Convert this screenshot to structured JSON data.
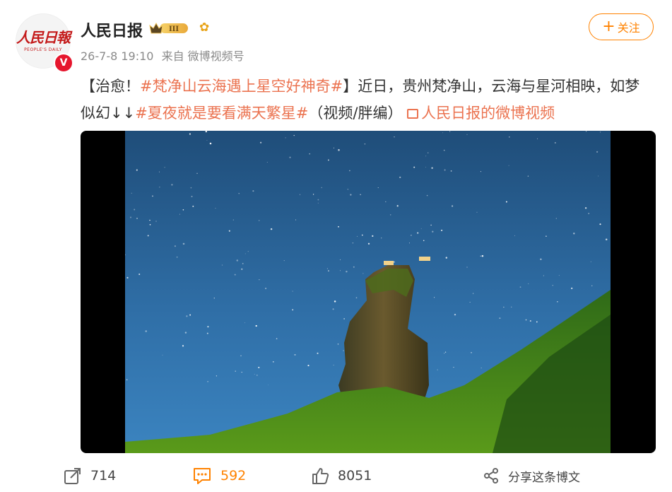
{
  "post": {
    "author": "人民日报",
    "avatar_logo": "人民日報",
    "avatar_logo_sub": "PEOPLE'S DAILY",
    "verified_mark": "V",
    "level_badge": "III",
    "timestamp": "26-7-8 19:10",
    "source": "来自 微博视频号",
    "follow_label": "关注",
    "follow_plus": "+",
    "text": {
      "p1": "【治愈！",
      "tag1": "#梵净山云海遇上星空好神奇#",
      "p2": "】近日，贵州梵净山，云海与星河相映，如梦似幻↓↓",
      "tag2": "#夏夜就是要看满天繁星#",
      "p3": "（视频/胖编）",
      "video_link": "人民日报的微博视频"
    }
  },
  "actions": {
    "repost_count": "714",
    "comment_count": "592",
    "like_count": "8051",
    "share_label": "分享这条博文"
  },
  "colors": {
    "accent": "#ff8200",
    "link": "#eb7350",
    "brand_red": "#e6162d"
  }
}
